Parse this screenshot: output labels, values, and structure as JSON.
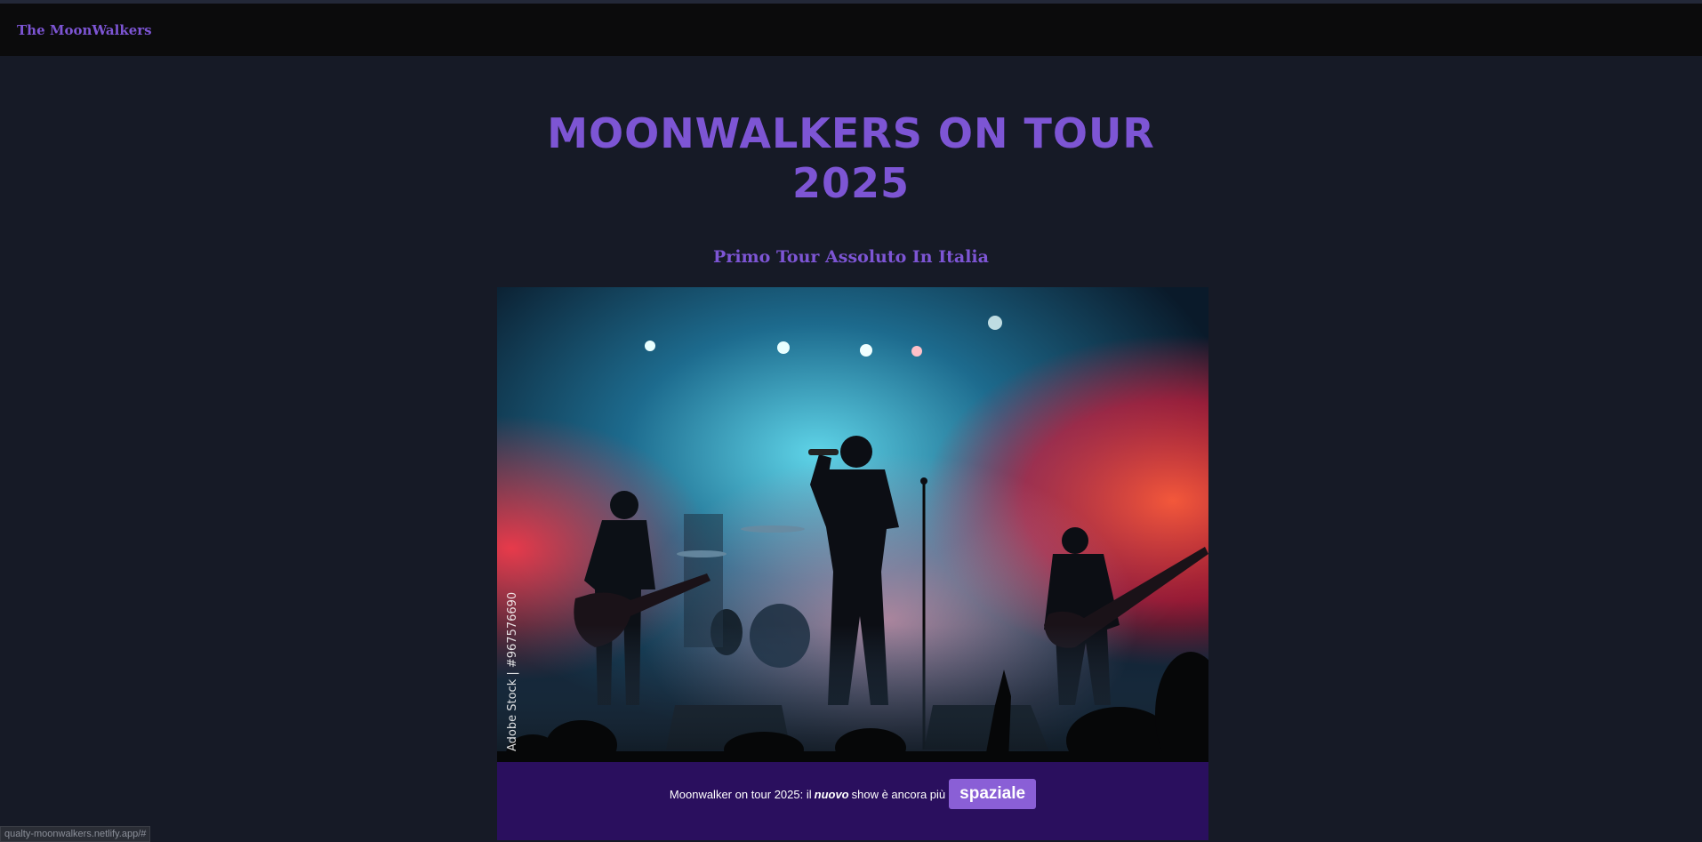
{
  "navbar": {
    "brand": "The MoonWalkers"
  },
  "hero": {
    "title_line1": "MOONWALKERS ON TOUR",
    "title_line2": "2025",
    "subtitle": "Primo Tour Assoluto In Italia"
  },
  "image": {
    "watermark": "Adobe Stock | #967576690"
  },
  "banner": {
    "text_before": "Moonwalker on tour 2025: il",
    "text_emphasis": "nuovo",
    "text_after": "show è ancora più",
    "badge": "spaziale"
  },
  "statusbar": {
    "url": "qualty-moonwalkers.netlify.app/#"
  },
  "colors": {
    "accent": "#7d55d4",
    "background": "#161a26",
    "navbar": "#0b0b0c",
    "banner": "#2a0f5e",
    "badge": "#8a5fd6"
  }
}
